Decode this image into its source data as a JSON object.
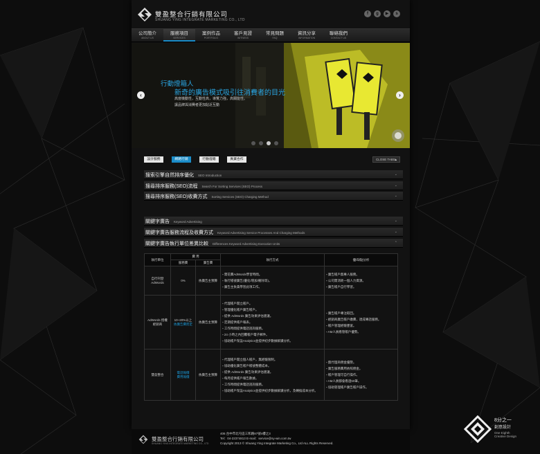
{
  "header": {
    "company_cn": "雙盈整合行銷有限公司",
    "company_en": "SHUANG YING INTEGRATE MARKETING CO., LTD",
    "social_icons": [
      "facebook-icon",
      "google-plus-icon",
      "youtube-icon",
      "skype-icon"
    ]
  },
  "nav": {
    "items": [
      {
        "cn": "公司簡介",
        "en": "ABOUT US"
      },
      {
        "cn": "服務項目",
        "en": "SERVICES"
      },
      {
        "cn": "案例作品",
        "en": "PORTFOLIO"
      },
      {
        "cn": "客戶見證",
        "en": "WITNESS"
      },
      {
        "cn": "常見問題",
        "en": "FAQ"
      },
      {
        "cn": "資訊分享",
        "en": "INFORMATION"
      },
      {
        "cn": "聯絡我們",
        "en": "CONTACT US"
      }
    ],
    "active_index": 1
  },
  "banner": {
    "headline1": "行動燈箱人",
    "headline2": "新奇的廣告模式吸引往消費者的目光",
    "line1": "高度機動性，互動性高，導覽力強，高關能性。",
    "line2": "讓品牌與消費者更加貼近互動",
    "sign_text": "行動燈箱人",
    "accent_color": "#1b8cc8"
  },
  "service_tabs": {
    "items": [
      "設計服務",
      "網路行銷",
      "行動燈箱",
      "異業合作"
    ],
    "active_index": 1,
    "close_label": "CLOSE TABS"
  },
  "accordion_group1": [
    {
      "title": "搜索引擎自然排序優化",
      "en": "SEO Introduction"
    },
    {
      "title": "搜尋排序服務(SEO)流程",
      "en": "Search For Sorting Services (SEO) Process"
    },
    {
      "title": "搜尋排序服務(SEO)收費方式",
      "en": "Sorting Services (SEO) Charging Method"
    }
  ],
  "accordion_group2": [
    {
      "title": "關鍵字廣告",
      "en": "Keyword Advertising"
    },
    {
      "title": "關鍵字廣告服務流程及收費方式",
      "en": "Keyword Advertising Service Processes And Charging Methods"
    },
    {
      "title": "關鍵字廣告執行單位差異比較",
      "en": "Differences Keyword Advertising Execution Units"
    }
  ],
  "table": {
    "h_unit": "執行單位",
    "h_cost": "費 用",
    "h_service_fee": "服務費",
    "h_ad_fee": "廣告費",
    "h_method": "執行方式",
    "h_analysis": "優/缺點分析",
    "rows": [
      {
        "unit": "自行刊登 AdWords",
        "service_fee": "0%",
        "service_fee_note": "",
        "ad_fee": "依廣告主預算",
        "method": [
          "需花費AdWords學習時間。",
          "執行帳號廣告(優化/增加/刪除等)。",
          "廣告主負責學習此項工作。"
        ],
        "analysis": [
          "廣告帳戶無專人服務。",
          "公司需消耗一個人力資源。",
          "廣告帳戶自行學習。"
        ]
      },
      {
        "unit": "AdWords 授權經銷商",
        "service_fee": "10~20%以上",
        "service_fee_note": "依廣告費而定",
        "ad_fee": "依廣告主預算",
        "method": [
          "代理帳戶開立帳戶。",
          "管理優化帳戶廣告帳戶。",
          "提供 AdWords 廣告效果評估建議。",
          "定期提供帳戶報表。",
          "工作時間提供電話諮詢服務。",
          "24 小時之內回覆帳戶電子郵件。",
          "協助帳戶架設Analytics並提供初步數據解讀分析。"
        ],
        "analysis": [
          "廣告帳戶專注取回。",
          "經銷商廣告帳戶繳費，達成專話服務。",
          "帳戶管理經驗豐富。",
          "AM人員看管帳戶優勢。"
        ]
      },
      {
        "unit": "雙盈整合",
        "service_fee": "電話報價",
        "service_fee_note": "費用報價",
        "ad_fee": "依廣告主預算",
        "method": [
          "代理帳戶開立個人帳戶，無經驗限制。",
          "協助優化廣告帳戶帳號整體成本。",
          "提供 AdWords 廣告效果評估建議。",
          "每月提供帳戶報告數據。",
          "工作時間提供電話諮詢服務。",
          "協助帳戶架設Analytics並提供初步數據解讀分析，及轉換成本分析。"
        ],
        "analysis": [
          "無代理商佣金優勢。",
          "廣告服務費用依照佣金。",
          "帳戶管理可自行操作。",
          "AM人員都會看過50筆。",
          "協助管理帳戶廣告帳戶操作。"
        ]
      }
    ]
  },
  "footer": {
    "company_cn": "雙盈整合行銷有限公司",
    "company_en": "SHUANG YING INTEGRATE MARKETING CO., LTD",
    "address": "406 台中市北屯區三和路87號4樓之3",
    "contact": "Tel：04-22374813  E-mail：service@sy-win.com.tw",
    "copyright": "Copyright 2013 © Shuang Ying Integrate Marketing Co., Ltd ALL Rights Reserved."
  },
  "designer": {
    "name_cn1": "8分之一",
    "name_cn2": "創意設計",
    "name_en1": "One Eighth",
    "name_en2": "Creative Design"
  }
}
